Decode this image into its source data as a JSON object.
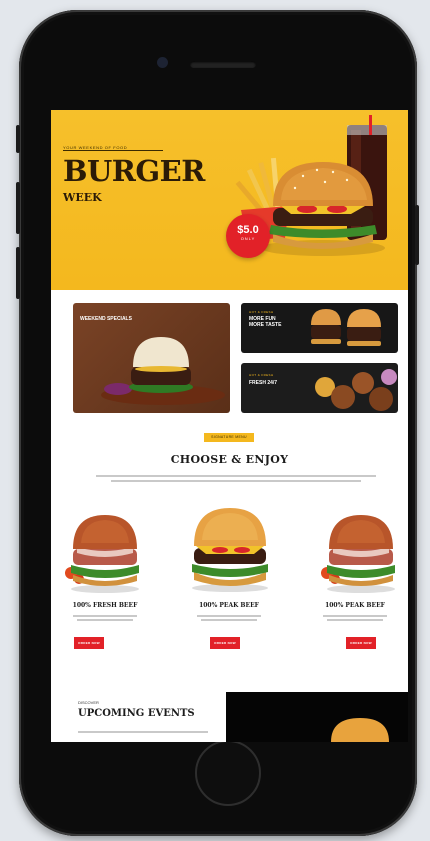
{
  "hero": {
    "subtitle": "YOUR WEEKEND OF FOOD",
    "title": "BURGER",
    "title_sub": "WEEK",
    "price": "$5.0",
    "price_unit": "ONLY"
  },
  "promo_tiles": [
    {
      "tag": "",
      "label": "WEEKEND SPECIALS"
    },
    {
      "tag": "HOT & FRESH",
      "label": "MORE FUN\nMORE TASTE"
    },
    {
      "tag": "HOT & FRESH",
      "label": "FRESH 24/7"
    }
  ],
  "section": {
    "badge": "SIGNATURE MENU",
    "title": "CHOOSE & ENJOY"
  },
  "burgers": [
    {
      "name": "100% FRESH BEEF",
      "button": "ORDER NOW"
    },
    {
      "name": "100% PEAK BEEF",
      "button": "ORDER NOW"
    },
    {
      "name": "100% PEAK BEEF",
      "button": "ORDER NOW"
    }
  ],
  "events": {
    "kicker": "DISCOVER",
    "title": "UPCOMING EVENTS"
  },
  "colors": {
    "accent_yellow": "#f4b81e",
    "accent_red": "#e22128",
    "phone_frame": "#0c0c0c",
    "background": "#e3e7ec"
  }
}
